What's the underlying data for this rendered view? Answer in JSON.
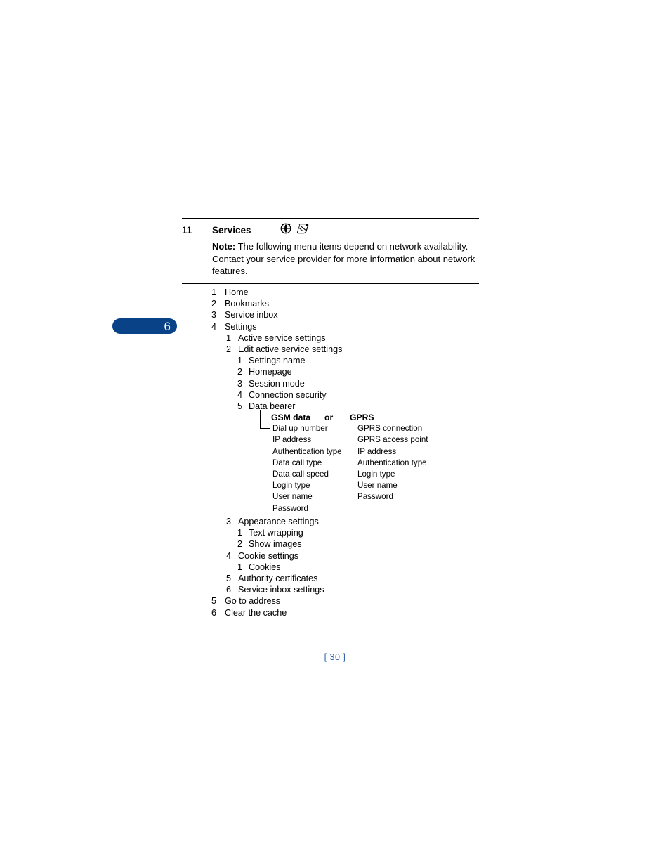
{
  "chapter_tab": {
    "number": "6"
  },
  "header": {
    "chapter_number": "11",
    "chapter_title": "Services",
    "icons": [
      {
        "name": "globe-icon",
        "label": "globe"
      },
      {
        "name": "wap-service-icon",
        "label": "wap service"
      }
    ],
    "note_label": "Note:",
    "note_text": " The following menu items depend on network availability. Contact your service provider for more information about network features."
  },
  "outline": [
    {
      "level": 1,
      "marker": "1",
      "label": "Home"
    },
    {
      "level": 1,
      "marker": "2",
      "label": "Bookmarks"
    },
    {
      "level": 1,
      "marker": "3",
      "label": "Service inbox"
    },
    {
      "level": 1,
      "marker": "4",
      "label": "Settings"
    },
    {
      "level": 2,
      "marker": "1",
      "label": "Active service settings"
    },
    {
      "level": 2,
      "marker": "2",
      "label": "Edit active service settings"
    },
    {
      "level": 3,
      "marker": "1",
      "label": "Settings name"
    },
    {
      "level": 3,
      "marker": "2",
      "label": "Homepage"
    },
    {
      "level": 3,
      "marker": "3",
      "label": "Session mode"
    },
    {
      "level": 3,
      "marker": "4",
      "label": "Connection security"
    },
    {
      "level": 3,
      "marker": "5",
      "label": "Data bearer"
    }
  ],
  "bearer": {
    "gsm_header": "GSM data",
    "or_word": "or",
    "gprs_header": "GPRS",
    "gsm_items": [
      "Dial up number",
      "IP address",
      "Authentication type",
      "Data call type",
      "Data call speed",
      "Login type",
      "User name",
      "Password"
    ],
    "gprs_items": [
      "GPRS connection",
      "GPRS access point",
      "IP address",
      "Authentication type",
      "Login type",
      "User name",
      "Password"
    ]
  },
  "outline_tail": [
    {
      "level": 2,
      "marker": "3",
      "label": "Appearance settings"
    },
    {
      "level": 3,
      "marker": "1",
      "label": "Text wrapping"
    },
    {
      "level": 3,
      "marker": "2",
      "label": "Show images"
    },
    {
      "level": 2,
      "marker": "4",
      "label": "Cookie settings"
    },
    {
      "level": 3,
      "marker": "1",
      "label": "Cookies"
    },
    {
      "level": 2,
      "marker": "5",
      "label": "Authority certificates"
    },
    {
      "level": 2,
      "marker": "6",
      "label": "Service inbox settings"
    },
    {
      "level": 1,
      "marker": "5",
      "label": "Go to address"
    },
    {
      "level": 1,
      "marker": "6",
      "label": "Clear the cache"
    }
  ],
  "footer": {
    "page_number": "[ 30 ]"
  },
  "colors": {
    "tab_blue": "#0A4288",
    "page_number_blue": "#2B5FA8"
  }
}
